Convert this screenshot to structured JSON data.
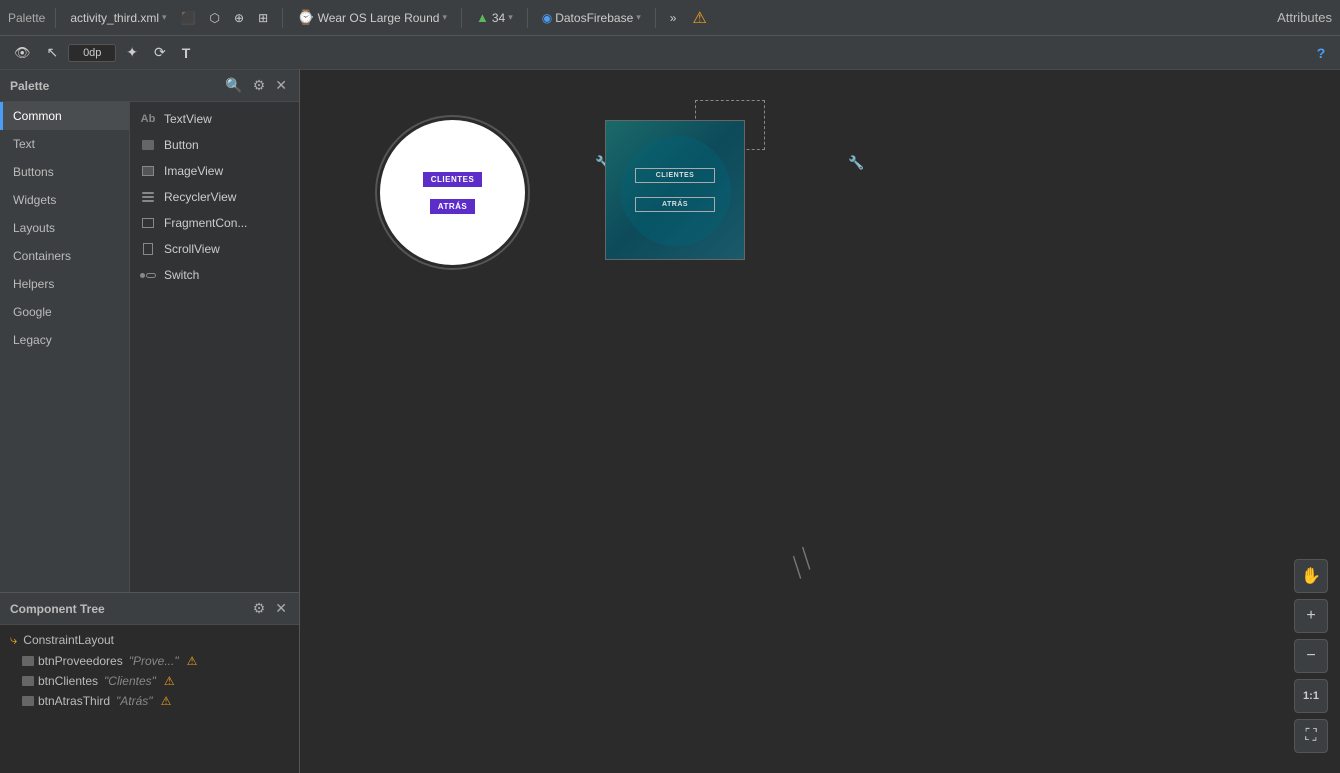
{
  "header": {
    "palette_label": "Palette",
    "file_name": "activity_third.xml",
    "design_icon": "▲",
    "blueprint_icon": "⬡",
    "both_icon": "⊕",
    "split_icon": "⊞",
    "device_label": "Wear OS Large Round",
    "api_level": "34",
    "firebase_label": "DatosFirebase",
    "more_label": "»",
    "warning_icon": "⚠",
    "attributes_label": "Attributes",
    "search_icon": "🔍",
    "settings_icon": "⚙",
    "close_icon": "✕"
  },
  "secondary_toolbar": {
    "eye_icon": "👁",
    "cursor_icon": "↖",
    "margin_value": "0dp",
    "magic_icon": "✦",
    "wand_icon": "⟳",
    "text_icon": "T",
    "help_icon": "?"
  },
  "palette": {
    "title": "Palette",
    "categories": [
      {
        "id": "common",
        "label": "Common",
        "active": true
      },
      {
        "id": "text",
        "label": "Text"
      },
      {
        "id": "buttons",
        "label": "Buttons"
      },
      {
        "id": "widgets",
        "label": "Widgets"
      },
      {
        "id": "layouts",
        "label": "Layouts"
      },
      {
        "id": "containers",
        "label": "Containers"
      },
      {
        "id": "helpers",
        "label": "Helpers"
      },
      {
        "id": "google",
        "label": "Google"
      },
      {
        "id": "legacy",
        "label": "Legacy"
      }
    ],
    "components": [
      {
        "id": "textview",
        "label": "TextView",
        "icon": "text"
      },
      {
        "id": "button",
        "label": "Button",
        "icon": "button"
      },
      {
        "id": "imageview",
        "label": "ImageView",
        "icon": "image"
      },
      {
        "id": "recyclerview",
        "label": "RecyclerView",
        "icon": "list"
      },
      {
        "id": "fragmentcon",
        "label": "FragmentCon...",
        "icon": "fragment"
      },
      {
        "id": "scrollview",
        "label": "ScrollView",
        "icon": "scroll"
      },
      {
        "id": "switch",
        "label": "Switch",
        "icon": "switch"
      }
    ]
  },
  "component_tree": {
    "title": "Component Tree",
    "items": [
      {
        "id": "constraint",
        "label": "ConstraintLayout",
        "icon": "constraint",
        "indent": 0
      },
      {
        "id": "btnProveedores",
        "label": "btnProveedores",
        "value": "\"Prove...\"",
        "icon": "btn",
        "indent": 1,
        "warning": true
      },
      {
        "id": "btnClientes",
        "label": "btnClientes",
        "value": "\"Clientes\"",
        "icon": "btn",
        "indent": 1,
        "warning": true
      },
      {
        "id": "btnAtrasThird",
        "label": "btnAtrasThird",
        "value": "\"Atrás\"",
        "icon": "btn",
        "indent": 1,
        "warning": true
      }
    ]
  },
  "canvas": {
    "btn_clientes_label": "CLIENTES",
    "btn_atras_label": "ATRÁS",
    "btn_clientes_teal_label": "CLIENTES",
    "btn_atras_teal_label": "ATRÁS"
  },
  "tools": {
    "pan_icon": "✋",
    "zoom_in_icon": "+",
    "zoom_out_icon": "−",
    "ratio_label": "1:1",
    "fit_icon": "⛶"
  }
}
